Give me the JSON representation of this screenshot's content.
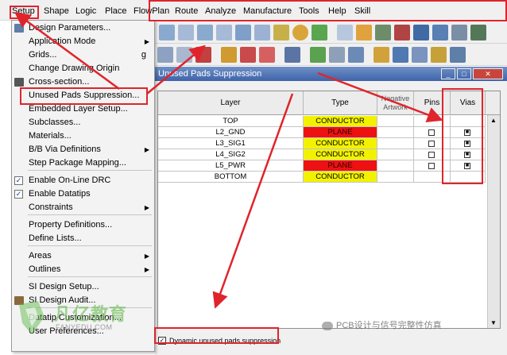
{
  "menubar": {
    "items": [
      "Setup",
      "Shape",
      "Logic",
      "Place",
      "FlowPlan",
      "Route",
      "Analyze",
      "Manufacture",
      "Tools",
      "Help",
      "Skill"
    ]
  },
  "setup_menu": {
    "items": [
      {
        "label": "Design Parameters...",
        "icon": "parameters-icon"
      },
      {
        "label": "Application Mode",
        "submenu": true
      },
      {
        "label": "Grids...",
        "shortcut": "g"
      },
      {
        "label": "Change Drawing Origin"
      },
      {
        "label": "Cross-section...",
        "icon": "cross-section-icon"
      },
      {
        "label": "Unused Pads Suppression..."
      },
      {
        "label": "Embedded Layer Setup..."
      },
      {
        "label": "Subclasses..."
      },
      {
        "label": "Materials..."
      },
      {
        "label": "B/B Via Definitions",
        "submenu": true
      },
      {
        "label": "Step Package Mapping..."
      },
      {
        "label": "Enable On-Line DRC",
        "checked": true
      },
      {
        "label": "Enable Datatips",
        "checked": true
      },
      {
        "label": "Constraints",
        "submenu": true
      },
      {
        "label": "Property Definitions..."
      },
      {
        "label": "Define Lists..."
      },
      {
        "label": "Areas",
        "submenu": true
      },
      {
        "label": "Outlines",
        "submenu": true
      },
      {
        "label": "SI Design Setup..."
      },
      {
        "label": "SI Design Audit...",
        "icon": "si-audit-icon"
      },
      {
        "label": "Datatip Customization..."
      },
      {
        "label": "User Preferences..."
      }
    ]
  },
  "dialog": {
    "title": "Unused Pads Suppression",
    "columns": [
      "Layer",
      "Type",
      "Negative Artwork",
      "Pins",
      "Vias"
    ],
    "rows": [
      {
        "layer": "TOP",
        "type": "CONDUCTOR",
        "pins": false,
        "vias": false
      },
      {
        "layer": "L2_GND",
        "type": "PLANE",
        "pins": true,
        "vias": true
      },
      {
        "layer": "L3_SIG1",
        "type": "CONDUCTOR",
        "pins": true,
        "vias": true
      },
      {
        "layer": "L4_SIG2",
        "type": "CONDUCTOR",
        "pins": true,
        "vias": true
      },
      {
        "layer": "L5_PWR",
        "type": "PLANE",
        "pins": true,
        "vias": true
      },
      {
        "layer": "BOTTOM",
        "type": "CONDUCTOR",
        "pins": false,
        "vias": false
      }
    ],
    "dynamic_suppression_label": "Dynamic unused pads suppression",
    "dynamic_suppression_checked": true
  },
  "colors": {
    "conductor": "#f2f200",
    "plane": "#ee1111",
    "annotation": "#e0242c"
  },
  "watermark": {
    "brand": "凡亿教育",
    "domain": "FANYEDU.COM",
    "account": "PCB设计与信号完整性仿真"
  }
}
